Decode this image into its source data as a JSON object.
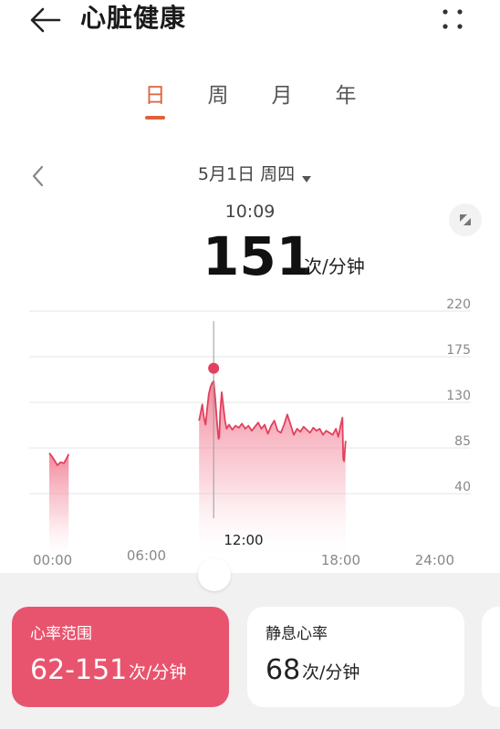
{
  "header": {
    "title": "心脏健康"
  },
  "tabs": [
    {
      "label": "日",
      "active": true
    },
    {
      "label": "周",
      "active": false
    },
    {
      "label": "月",
      "active": false
    },
    {
      "label": "年",
      "active": false
    }
  ],
  "date": {
    "label": "5月1日 周四"
  },
  "reading": {
    "time": "10:09",
    "value": "151",
    "unit": "次/分钟"
  },
  "colors": {
    "accent": "#e0603a",
    "heart_line": "#e2405e",
    "card_range": "#e8546e"
  },
  "chart_data": {
    "type": "area",
    "x_ticks": [
      "00:00",
      "06:00",
      "12:00",
      "18:00",
      "24:00"
    ],
    "y_ticks": [
      "220",
      "175",
      "130",
      "85",
      "40"
    ],
    "ylim": [
      0,
      220
    ],
    "x_unit": "hours",
    "xlim": [
      0,
      24
    ],
    "selected": {
      "x": 10.15,
      "y": 151
    },
    "series": [
      {
        "segments": [
          [
            [
              0.0,
              80
            ],
            [
              0.2,
              76
            ],
            [
              0.35,
              72
            ],
            [
              0.5,
              68
            ],
            [
              0.7,
              71
            ],
            [
              0.9,
              70
            ],
            [
              1.05,
              74
            ],
            [
              1.2,
              79
            ]
          ],
          [
            [
              9.25,
              112
            ],
            [
              9.35,
              120
            ],
            [
              9.45,
              128
            ],
            [
              9.55,
              115
            ],
            [
              9.65,
              108
            ],
            [
              9.75,
              124
            ],
            [
              9.85,
              138
            ],
            [
              9.95,
              145
            ],
            [
              10.05,
              149
            ],
            [
              10.15,
              151
            ],
            [
              10.25,
              134
            ],
            [
              10.35,
              112
            ],
            [
              10.45,
              94
            ],
            [
              10.5,
              96
            ],
            [
              10.55,
              120
            ],
            [
              10.65,
              140
            ],
            [
              10.75,
              126
            ],
            [
              10.85,
              112
            ],
            [
              10.95,
              104
            ],
            [
              11.1,
              108
            ],
            [
              11.3,
              103
            ],
            [
              11.5,
              107
            ],
            [
              11.7,
              105
            ],
            [
              11.9,
              109
            ],
            [
              12.1,
              104
            ],
            [
              12.3,
              107
            ],
            [
              12.5,
              102
            ],
            [
              12.7,
              106
            ],
            [
              12.9,
              110
            ],
            [
              13.1,
              104
            ],
            [
              13.3,
              108
            ],
            [
              13.5,
              99
            ],
            [
              13.7,
              107
            ],
            [
              13.9,
              112
            ],
            [
              14.1,
              102
            ],
            [
              14.3,
              100
            ],
            [
              14.5,
              108
            ],
            [
              14.7,
              118
            ],
            [
              14.9,
              108
            ],
            [
              15.1,
              98
            ],
            [
              15.3,
              104
            ],
            [
              15.5,
              101
            ],
            [
              15.7,
              106
            ],
            [
              15.9,
              103
            ],
            [
              16.1,
              100
            ],
            [
              16.3,
              105
            ],
            [
              16.5,
              102
            ],
            [
              16.7,
              104
            ],
            [
              16.9,
              98
            ],
            [
              17.1,
              102
            ],
            [
              17.3,
              100
            ],
            [
              17.5,
              98
            ],
            [
              17.7,
              104
            ],
            [
              17.85,
              96
            ],
            [
              18.0,
              108
            ],
            [
              18.1,
              115
            ],
            [
              18.15,
              74
            ],
            [
              18.2,
              72
            ],
            [
              18.3,
              92
            ]
          ]
        ]
      }
    ]
  },
  "cards": {
    "range": {
      "title": "心率范围",
      "value": "62-151",
      "unit": "次/分钟"
    },
    "rest": {
      "title": "静息心率",
      "value": "68",
      "unit": "次/分钟"
    }
  }
}
